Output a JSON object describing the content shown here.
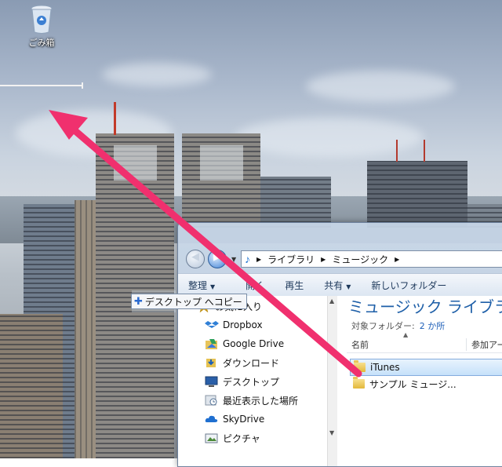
{
  "desktop": {
    "recycle_bin_label": "ごみ箱"
  },
  "drag_tooltip": {
    "text": "デスクトップ へコピー"
  },
  "explorer": {
    "address": {
      "crumbs": [
        "ライブラリ",
        "ミュージック"
      ]
    },
    "toolbar": {
      "organize": "整理",
      "open": "開く",
      "play": "再生",
      "share": "共有",
      "new_folder": "新しいフォルダー"
    },
    "nav_pane": {
      "items": [
        {
          "label": "お気に入り",
          "icon": "star-icon"
        },
        {
          "label": "Dropbox",
          "icon": "dropbox-icon"
        },
        {
          "label": "Google Drive",
          "icon": "google-drive-icon"
        },
        {
          "label": "ダウンロード",
          "icon": "download-folder-icon"
        },
        {
          "label": "デスクトップ",
          "icon": "desktop-icon"
        },
        {
          "label": "最近表示した場所",
          "icon": "recent-places-icon"
        },
        {
          "label": "SkyDrive",
          "icon": "skydrive-icon"
        },
        {
          "label": "ピクチャ",
          "icon": "pictures-icon"
        }
      ]
    },
    "library": {
      "title": "ミュージック ライブラ",
      "subtitle_label": "対象フォルダー:",
      "subtitle_link": "2 か所",
      "columns": {
        "name": "名前",
        "artist": "参加アー"
      },
      "files": [
        {
          "name": "iTunes",
          "selected": true
        },
        {
          "name": "サンプル ミュージ...",
          "selected": false
        }
      ]
    }
  },
  "colors": {
    "drag_arrow": "#f0306e",
    "library_title": "#1e5fa8",
    "selection": "#c6e1fa"
  }
}
